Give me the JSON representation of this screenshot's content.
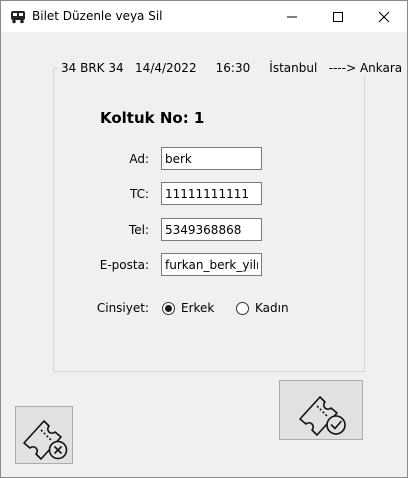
{
  "window": {
    "title": "Bilet Düzenle veya Sil",
    "icon": "bus-icon",
    "controls": [
      "minimize-icon",
      "maximize-icon",
      "close-icon"
    ]
  },
  "trip": {
    "caption": "34 BRK 34   14/4/2022     16:30     İstanbul   ----> Ankara"
  },
  "form": {
    "heading": "Koltuk No: 1",
    "name_label": "Ad:",
    "name_value": "berk",
    "tc_label": "TC:",
    "tc_value": "11111111111",
    "phone_label": "Tel:",
    "phone_value": "5349368868",
    "email_label": "E-posta:",
    "email_value": "furkan_berk_yilmaz",
    "gender_label": "Cinsiyet:",
    "gender_options": [
      "Erkek",
      "Kadın"
    ],
    "gender_selected": "Erkek"
  },
  "actions": {
    "delete_icon": "ticket-delete-icon",
    "confirm_icon": "ticket-check-icon"
  }
}
